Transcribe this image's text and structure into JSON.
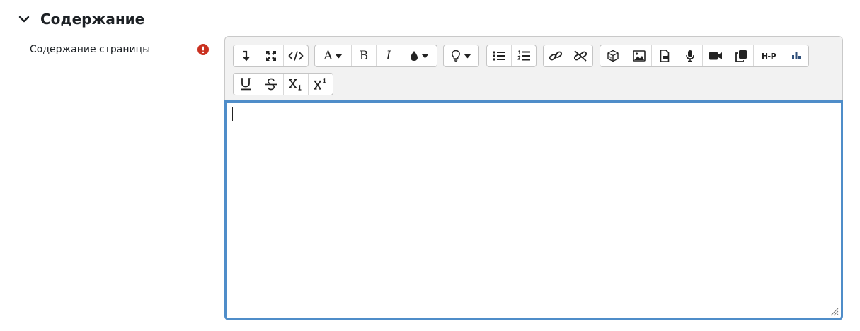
{
  "section": {
    "title": "Содержание",
    "chevron_icon": "chevron-down-icon"
  },
  "field": {
    "label": "Содержание страницы",
    "required_icon": "exclamation-circle-icon",
    "required_color": "#ca3120"
  },
  "editor": {
    "focus_border_color": "#4f8dc9",
    "toolbar_row1": [
      [
        "collapse-icon",
        "fullscreen-icon",
        "code-view-icon"
      ],
      [
        "font-color-icon",
        "bold-icon",
        "italic-icon",
        "highlight-color-icon"
      ],
      [
        "lightbulb-dropdown-icon"
      ],
      [
        "unordered-list-icon",
        "ordered-list-icon"
      ],
      [
        "link-icon",
        "unlink-icon"
      ],
      [
        "cube-icon",
        "image-icon",
        "file-icon",
        "microphone-icon",
        "video-icon",
        "copy-icon",
        "h5p-icon",
        "bar-chart-icon"
      ]
    ],
    "toolbar_row2": [
      [
        "underline-icon",
        "strikethrough-icon",
        "subscript-icon",
        "superscript-icon"
      ]
    ],
    "labels": {
      "font_color": "A",
      "bold": "B",
      "italic": "I",
      "h5p": "H-P"
    }
  }
}
